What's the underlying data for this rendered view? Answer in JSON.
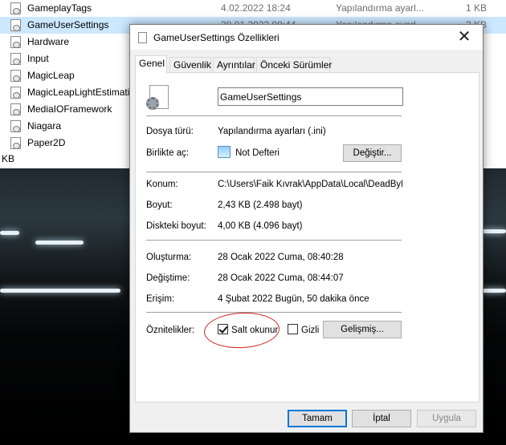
{
  "explorer": {
    "files": [
      {
        "name": "GameplayTags",
        "date": "4.02.2022 18:24",
        "type": "Yapılandırma ayarl...",
        "size": "1 KB",
        "selected": false
      },
      {
        "name": "GameUserSettings",
        "date": "28.01.2022 08:44",
        "type": "Yapılandırma ayarl...",
        "size": "3 KB",
        "selected": true
      },
      {
        "name": "Hardware",
        "date": "",
        "type": "",
        "size": "",
        "selected": false
      },
      {
        "name": "Input",
        "date": "",
        "type": "",
        "size": "",
        "selected": false
      },
      {
        "name": "MagicLeap",
        "date": "",
        "type": "",
        "size": "",
        "selected": false
      },
      {
        "name": "MagicLeapLightEstimati",
        "date": "",
        "type": "",
        "size": "",
        "selected": false
      },
      {
        "name": "MediaIOFramework",
        "date": "",
        "type": "",
        "size": "",
        "selected": false
      },
      {
        "name": "Niagara",
        "date": "",
        "type": "",
        "size": "",
        "selected": false
      },
      {
        "name": "Paper2D",
        "date": "",
        "type": "",
        "size": "",
        "selected": false
      }
    ],
    "status_size": "KB"
  },
  "dialog": {
    "title": "GameUserSettings Özellikleri",
    "close_glyph": "✕",
    "tabs": [
      {
        "label": "Genel",
        "active": true
      },
      {
        "label": "Güvenlik",
        "active": false
      },
      {
        "label": "Ayrıntılar",
        "active": false
      },
      {
        "label": "Önceki Sürümler",
        "active": false
      }
    ],
    "file_name": "GameUserSettings",
    "file_type_label": "Dosya türü:",
    "file_type_value": "Yapılandırma ayarları (.ini)",
    "opens_with_label": "Birlikte aç:",
    "opens_with_value": "Not Defteri",
    "change_button": "Değiştir...",
    "location_label": "Konum:",
    "location_value": "C:\\Users\\Faik Kıvrak\\AppData\\Local\\DeadByDa",
    "size_label": "Boyut:",
    "size_value": "2,43 KB (2.498 bayt)",
    "size_on_disk_label": "Diskteki boyut:",
    "size_on_disk_value": "4,00 KB (4.096 bayt)",
    "created_label": "Oluşturma:",
    "created_value": "28 Ocak 2022 Cuma, 08:40:28",
    "modified_label": "Değiştime:",
    "modified_value": "28 Ocak 2022 Cuma, 08:44:07",
    "accessed_label": "Erişim:",
    "accessed_value": "4 Şubat 2022 Bugün, 50 dakika önce",
    "attributes_label": "Öznitelikler:",
    "readonly_label": "Salt okunur",
    "readonly_checked": true,
    "hidden_label": "Gizli",
    "hidden_checked": false,
    "advanced_button": "Gelişmiş...",
    "ok_button": "Tamam",
    "cancel_button": "İptal",
    "apply_button": "Uygula"
  },
  "colors": {
    "selection": "#cce8ff",
    "primary_border": "#0078d7",
    "annotation": "#d42020"
  }
}
